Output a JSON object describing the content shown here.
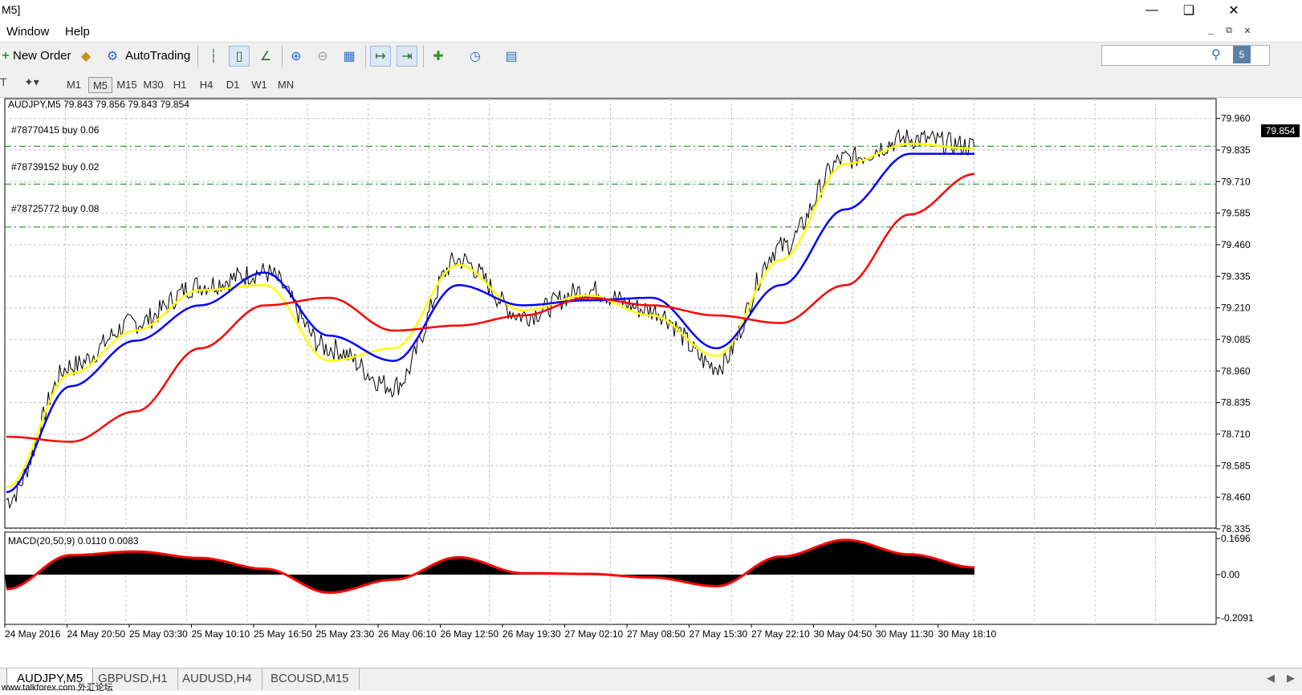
{
  "window": {
    "title": "M5]"
  },
  "menu": {
    "items": [
      "Window",
      "Help"
    ]
  },
  "toolbar": {
    "new_order": "New Order",
    "autotrading": "AutoTrading"
  },
  "timeframes": {
    "items": [
      "M1",
      "M5",
      "M15",
      "M30",
      "H1",
      "H4",
      "D1",
      "W1",
      "MN"
    ],
    "active": "M5"
  },
  "chart": {
    "header": "AUDJPY,M5  79.843 79.856 79.843 79.854",
    "current_price": "79.854",
    "orders": [
      {
        "label": "#78770415 buy 0.06",
        "price": 79.85
      },
      {
        "label": "#78739152 buy 0.02",
        "price": 79.7
      },
      {
        "label": "#78725772 buy 0.08",
        "price": 79.53
      }
    ],
    "price_ticks": [
      "79.960",
      "79.835",
      "79.710",
      "79.585",
      "79.460",
      "79.335",
      "79.210",
      "79.085",
      "78.960",
      "78.835",
      "78.710",
      "78.585",
      "78.460",
      "78.335"
    ],
    "time_labels": [
      "24 May 2016",
      "24 May 20:50",
      "25 May 03:30",
      "25 May 10:10",
      "25 May 16:50",
      "25 May 23:30",
      "26 May 06:10",
      "26 May 12:50",
      "26 May 19:30",
      "27 May 02:10",
      "27 May 08:50",
      "27 May 15:30",
      "27 May 22:10",
      "30 May 04:50",
      "30 May 11:30",
      "30 May 18:10"
    ],
    "colors": {
      "price": "#000000",
      "ma_fast": "#ffff00",
      "ma_mid": "#0000ff",
      "ma_slow": "#ff0000",
      "order_line": "#008000",
      "grid": "#c0c0c0"
    }
  },
  "macd": {
    "header": "MACD(20,50,9) 0.0110 0.0083",
    "ticks": [
      "0.1696",
      "0.00",
      "-0.2091"
    ]
  },
  "chart_data": {
    "type": "line",
    "title": "AUDJPY,M5",
    "ylim": [
      78.3,
      80.0
    ],
    "x": [
      "24 May 2016",
      "24 May 20:50",
      "25 May 03:30",
      "25 May 10:10",
      "25 May 16:50",
      "25 May 23:30",
      "26 May 06:10",
      "26 May 12:50",
      "26 May 19:30",
      "27 May 02:10",
      "27 May 08:50",
      "27 May 15:30",
      "27 May 22:10",
      "30 May 04:50",
      "30 May 11:30",
      "30 May 18:10"
    ],
    "series": [
      {
        "values": [
          78.45,
          78.98,
          79.15,
          79.3,
          79.35,
          79.05,
          78.9,
          79.4,
          79.18,
          79.28,
          79.2,
          78.98,
          79.45,
          79.8,
          79.88,
          79.85
        ]
      },
      {
        "values": [
          78.5,
          78.95,
          79.12,
          79.28,
          79.3,
          79.0,
          79.05,
          79.38,
          79.2,
          79.26,
          79.18,
          79.02,
          79.4,
          79.78,
          79.86,
          79.84
        ]
      },
      {
        "values": [
          78.48,
          78.9,
          79.08,
          79.22,
          79.35,
          79.1,
          79.0,
          79.3,
          79.22,
          79.24,
          79.25,
          79.05,
          79.3,
          79.6,
          79.82,
          79.82
        ]
      },
      {
        "values": [
          78.7,
          78.68,
          78.8,
          79.05,
          79.22,
          79.25,
          79.12,
          79.14,
          79.18,
          79.25,
          79.22,
          79.18,
          79.15,
          79.3,
          79.58,
          79.74
        ]
      }
    ]
  },
  "tabs": {
    "items": [
      "AUDJPY,M5",
      "GBPUSD,H1",
      "AUDUSD,H4",
      "BCOUSD,M15"
    ],
    "active": "AUDJPY,M5"
  },
  "watermark": "www.talkforex.com 外汇论坛"
}
